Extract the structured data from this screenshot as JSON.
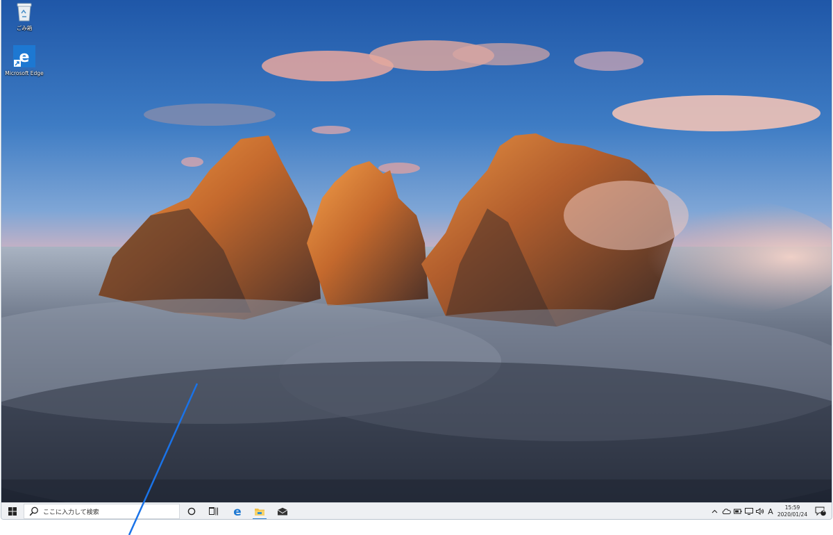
{
  "desktop": {
    "icons": [
      {
        "label": "ごみ箱",
        "icon": "recycle-bin-icon"
      },
      {
        "label": "Microsoft Edge",
        "icon": "edge-icon"
      }
    ]
  },
  "taskbar": {
    "start_icon": "windows-start-icon",
    "search_placeholder": "ここに入力して検索",
    "pinned": [
      "cortana-icon",
      "task-view-icon",
      "edge-icon",
      "file-explorer-icon",
      "mail-icon"
    ],
    "tray": {
      "icons": [
        "chevron-up-icon",
        "onedrive-icon",
        "battery-icon",
        "network-icon",
        "volume-icon"
      ],
      "ime_indicator": "A",
      "time": "15:59",
      "date": "2020/01/24",
      "notification_count": "2"
    }
  },
  "colors": {
    "callout": "#1a73e8",
    "taskbar_bg": "#eef0f3",
    "edge_blue": "#1d78d2"
  }
}
